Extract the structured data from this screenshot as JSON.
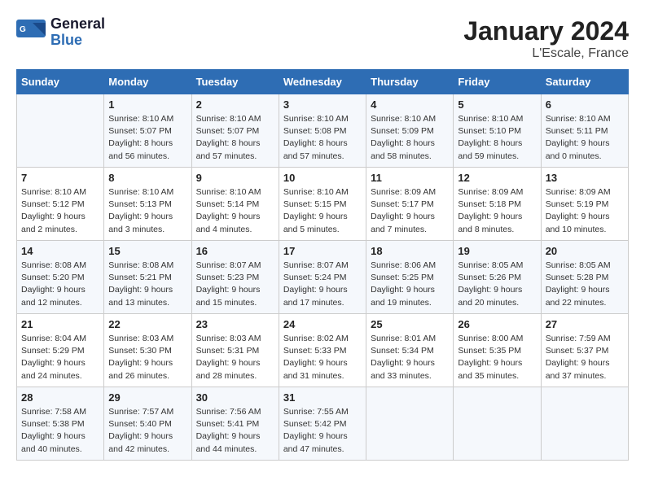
{
  "header": {
    "logo_general": "General",
    "logo_blue": "Blue",
    "title": "January 2024",
    "subtitle": "L'Escale, France"
  },
  "days_of_week": [
    "Sunday",
    "Monday",
    "Tuesday",
    "Wednesday",
    "Thursday",
    "Friday",
    "Saturday"
  ],
  "weeks": [
    [
      {
        "day": "",
        "info": ""
      },
      {
        "day": "1",
        "info": "Sunrise: 8:10 AM\nSunset: 5:07 PM\nDaylight: 8 hours\nand 56 minutes."
      },
      {
        "day": "2",
        "info": "Sunrise: 8:10 AM\nSunset: 5:07 PM\nDaylight: 8 hours\nand 57 minutes."
      },
      {
        "day": "3",
        "info": "Sunrise: 8:10 AM\nSunset: 5:08 PM\nDaylight: 8 hours\nand 57 minutes."
      },
      {
        "day": "4",
        "info": "Sunrise: 8:10 AM\nSunset: 5:09 PM\nDaylight: 8 hours\nand 58 minutes."
      },
      {
        "day": "5",
        "info": "Sunrise: 8:10 AM\nSunset: 5:10 PM\nDaylight: 8 hours\nand 59 minutes."
      },
      {
        "day": "6",
        "info": "Sunrise: 8:10 AM\nSunset: 5:11 PM\nDaylight: 9 hours\nand 0 minutes."
      }
    ],
    [
      {
        "day": "7",
        "info": "Sunrise: 8:10 AM\nSunset: 5:12 PM\nDaylight: 9 hours\nand 2 minutes."
      },
      {
        "day": "8",
        "info": "Sunrise: 8:10 AM\nSunset: 5:13 PM\nDaylight: 9 hours\nand 3 minutes."
      },
      {
        "day": "9",
        "info": "Sunrise: 8:10 AM\nSunset: 5:14 PM\nDaylight: 9 hours\nand 4 minutes."
      },
      {
        "day": "10",
        "info": "Sunrise: 8:10 AM\nSunset: 5:15 PM\nDaylight: 9 hours\nand 5 minutes."
      },
      {
        "day": "11",
        "info": "Sunrise: 8:09 AM\nSunset: 5:17 PM\nDaylight: 9 hours\nand 7 minutes."
      },
      {
        "day": "12",
        "info": "Sunrise: 8:09 AM\nSunset: 5:18 PM\nDaylight: 9 hours\nand 8 minutes."
      },
      {
        "day": "13",
        "info": "Sunrise: 8:09 AM\nSunset: 5:19 PM\nDaylight: 9 hours\nand 10 minutes."
      }
    ],
    [
      {
        "day": "14",
        "info": "Sunrise: 8:08 AM\nSunset: 5:20 PM\nDaylight: 9 hours\nand 12 minutes."
      },
      {
        "day": "15",
        "info": "Sunrise: 8:08 AM\nSunset: 5:21 PM\nDaylight: 9 hours\nand 13 minutes."
      },
      {
        "day": "16",
        "info": "Sunrise: 8:07 AM\nSunset: 5:23 PM\nDaylight: 9 hours\nand 15 minutes."
      },
      {
        "day": "17",
        "info": "Sunrise: 8:07 AM\nSunset: 5:24 PM\nDaylight: 9 hours\nand 17 minutes."
      },
      {
        "day": "18",
        "info": "Sunrise: 8:06 AM\nSunset: 5:25 PM\nDaylight: 9 hours\nand 19 minutes."
      },
      {
        "day": "19",
        "info": "Sunrise: 8:05 AM\nSunset: 5:26 PM\nDaylight: 9 hours\nand 20 minutes."
      },
      {
        "day": "20",
        "info": "Sunrise: 8:05 AM\nSunset: 5:28 PM\nDaylight: 9 hours\nand 22 minutes."
      }
    ],
    [
      {
        "day": "21",
        "info": "Sunrise: 8:04 AM\nSunset: 5:29 PM\nDaylight: 9 hours\nand 24 minutes."
      },
      {
        "day": "22",
        "info": "Sunrise: 8:03 AM\nSunset: 5:30 PM\nDaylight: 9 hours\nand 26 minutes."
      },
      {
        "day": "23",
        "info": "Sunrise: 8:03 AM\nSunset: 5:31 PM\nDaylight: 9 hours\nand 28 minutes."
      },
      {
        "day": "24",
        "info": "Sunrise: 8:02 AM\nSunset: 5:33 PM\nDaylight: 9 hours\nand 31 minutes."
      },
      {
        "day": "25",
        "info": "Sunrise: 8:01 AM\nSunset: 5:34 PM\nDaylight: 9 hours\nand 33 minutes."
      },
      {
        "day": "26",
        "info": "Sunrise: 8:00 AM\nSunset: 5:35 PM\nDaylight: 9 hours\nand 35 minutes."
      },
      {
        "day": "27",
        "info": "Sunrise: 7:59 AM\nSunset: 5:37 PM\nDaylight: 9 hours\nand 37 minutes."
      }
    ],
    [
      {
        "day": "28",
        "info": "Sunrise: 7:58 AM\nSunset: 5:38 PM\nDaylight: 9 hours\nand 40 minutes."
      },
      {
        "day": "29",
        "info": "Sunrise: 7:57 AM\nSunset: 5:40 PM\nDaylight: 9 hours\nand 42 minutes."
      },
      {
        "day": "30",
        "info": "Sunrise: 7:56 AM\nSunset: 5:41 PM\nDaylight: 9 hours\nand 44 minutes."
      },
      {
        "day": "31",
        "info": "Sunrise: 7:55 AM\nSunset: 5:42 PM\nDaylight: 9 hours\nand 47 minutes."
      },
      {
        "day": "",
        "info": ""
      },
      {
        "day": "",
        "info": ""
      },
      {
        "day": "",
        "info": ""
      }
    ]
  ]
}
